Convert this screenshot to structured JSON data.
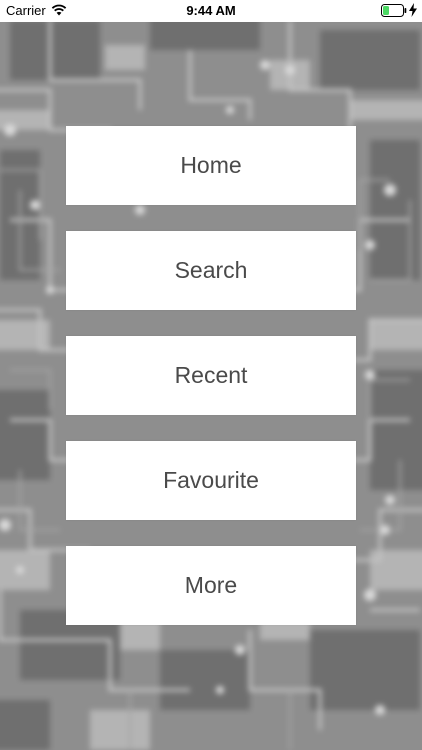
{
  "status_bar": {
    "carrier": "Carrier",
    "time": "9:44 AM",
    "battery_color": "#4cd964"
  },
  "menu": {
    "items": [
      {
        "label": "Home"
      },
      {
        "label": "Search"
      },
      {
        "label": "Recent"
      },
      {
        "label": "Favourite"
      },
      {
        "label": "More"
      }
    ]
  },
  "colors": {
    "background": "#8c8c8c",
    "button_background": "#ffffff",
    "button_text": "#4a4a4a"
  }
}
